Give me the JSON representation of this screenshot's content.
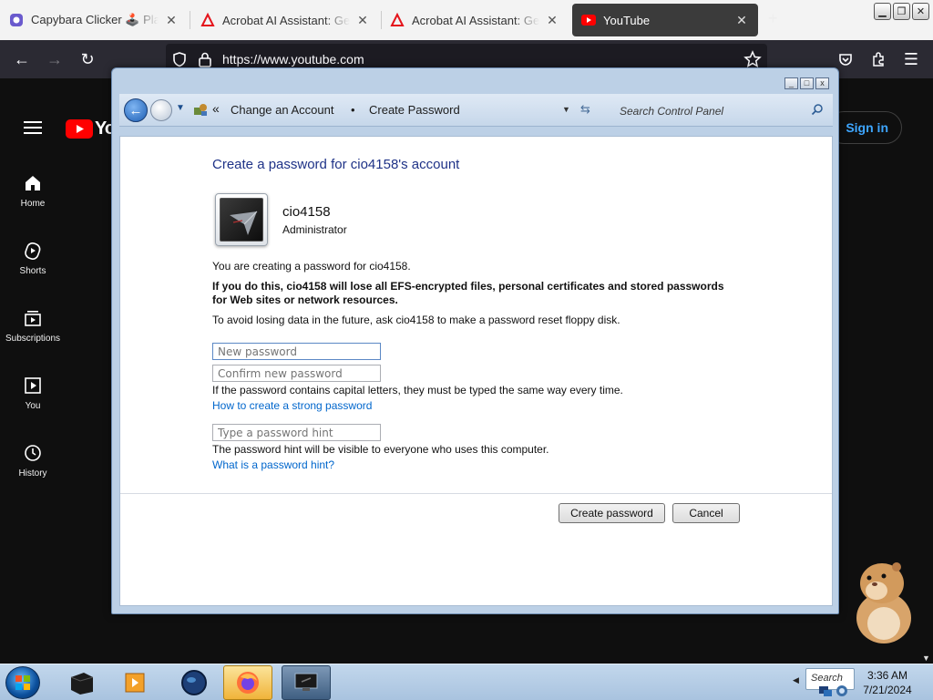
{
  "browser": {
    "tabs": [
      {
        "title": "Capybara Clicker 🕹️ Play online",
        "icon": "capybara-favicon"
      },
      {
        "title": "Acrobat AI Assistant: Generative AI",
        "icon": "acrobat-favicon"
      },
      {
        "title": "Acrobat AI Assistant: Generative AI",
        "icon": "acrobat-favicon"
      },
      {
        "title": "YouTube",
        "icon": "youtube-favicon",
        "active": true
      }
    ],
    "url": "https://www.youtube.com"
  },
  "youtube": {
    "logo": "YouTube",
    "signin": "Sign in",
    "sidebar": [
      {
        "label": "Home",
        "icon": "home-icon"
      },
      {
        "label": "Shorts",
        "icon": "shorts-icon"
      },
      {
        "label": "Subscriptions",
        "icon": "subscriptions-icon"
      },
      {
        "label": "You",
        "icon": "you-icon"
      },
      {
        "label": "History",
        "icon": "history-icon"
      }
    ]
  },
  "control_panel": {
    "breadcrumb": [
      "Change an Account",
      "Create Password"
    ],
    "search_placeholder": "Search Control Panel",
    "heading": "Create a password for cio4158's account",
    "user": {
      "name": "cio4158",
      "role": "Administrator"
    },
    "intro": "You are creating a password for cio4158.",
    "warning": "If you do this, cio4158 will lose all EFS-encrypted files, personal certificates and stored passwords for Web sites or network resources.",
    "advice": "To avoid losing data in the future, ask cio4158 to make a password reset floppy disk.",
    "fields": {
      "new_password": "New password",
      "confirm_password": "Confirm new password",
      "hint": "Type a password hint"
    },
    "caps_note": "If the password contains capital letters, they must be typed the same way every time.",
    "strong_link": "How to create a strong password",
    "hint_note": "The password hint will be visible to everyone who uses this computer.",
    "hint_link": "What is a password hint?",
    "buttons": {
      "create": "Create password",
      "cancel": "Cancel"
    }
  },
  "taskbar": {
    "search_text": "Search",
    "time": "3:36 AM",
    "date": "7/21/2024"
  },
  "colors": {
    "youtube_red": "#ff0000",
    "link_blue": "#0066cc",
    "heading_blue": "#1e3287",
    "signin_blue": "#3ea6ff"
  }
}
